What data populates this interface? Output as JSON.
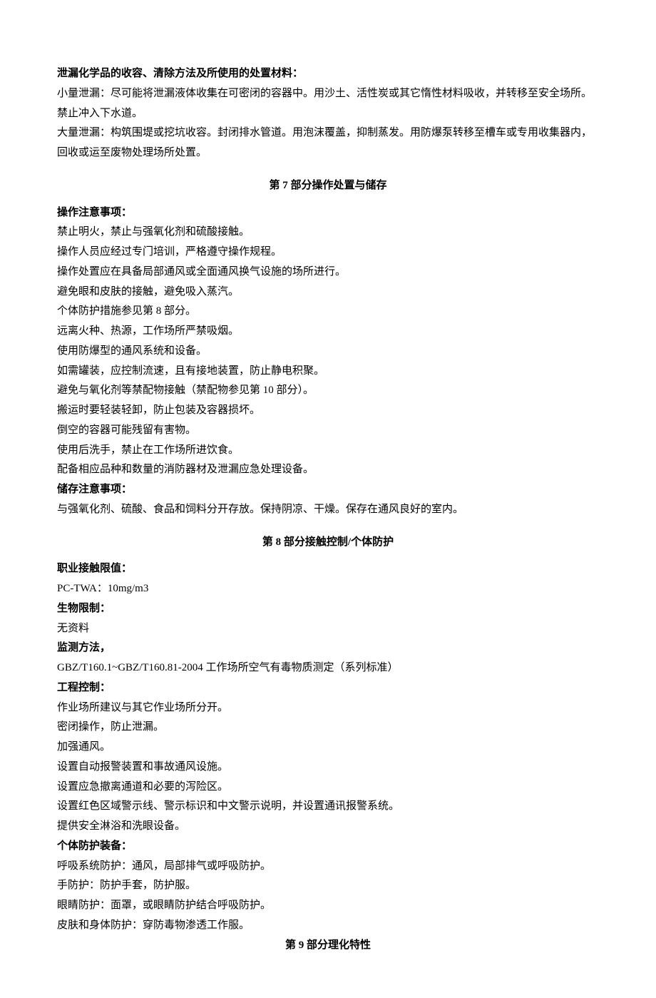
{
  "section6": {
    "heading1": "泄漏化学品的收容、清除方法及所使用的处置材料：",
    "para1": "小量泄漏：尽可能将泄漏液体收集在可密闭的容器中。用沙土、活性炭或其它惰性材料吸收，并转移至安全场所。禁止冲入下水道。",
    "para2": "大量泄漏：构筑围堤或挖坑收容。封闭排水管道。用泡沫覆盖，抑制蒸发。用防爆泵转移至槽车或专用收集器内，回收或运至废物处理场所处置。"
  },
  "section7": {
    "title": "第 7 部分操作处置与储存",
    "heading1": "操作注意事项：",
    "items1": [
      "禁止明火，禁止与强氧化剂和硫酸接触。",
      "操作人员应经过专门培训，严格遵守操作规程。",
      "操作处置应在具备局部通风或全面通风换气设施的场所进行。",
      "避免眼和皮肤的接触，避免吸入蒸汽。",
      "个体防护措施参见第 8 部分。",
      "远离火种、热源，工作场所严禁吸烟。",
      "使用防爆型的通风系统和设备。",
      "如需罐装，应控制流速，且有接地装置，防止静电积聚。",
      "避免与氧化剂等禁配物接触（禁配物参见第 10 部分）。",
      "搬运时要轻装轻卸，防止包装及容器损坏。",
      "倒空的容器可能残留有害物。",
      "使用后洗手，禁止在工作场所进饮食。",
      "配备相应品种和数量的消防器材及泄漏应急处理设备。"
    ],
    "heading2": "储存注意事项：",
    "para2": "与强氧化剂、硫酸、食品和饲料分开存放。保持阴凉、干燥。保存在通风良好的室内。"
  },
  "section8": {
    "title": "第 8 部分接触控制/个体防护",
    "heading1": "职业接触限值：",
    "val1": "PC-TWA：10mg/m3",
    "heading2": "生物限制：",
    "val2": "无资料",
    "heading3": "监测方法，",
    "val3": "GBZ/T160.1~GBZ/T160.81-2004 工作场所空气有毒物质测定（系列标准）",
    "heading4": "工程控制：",
    "items4": [
      "作业场所建议与其它作业场所分开。",
      "密闭操作，防止泄漏。",
      "加强通风。",
      "设置自动报警装置和事故通风设施。",
      "设置应急撤离通道和必要的泻险区。",
      "设置红色区域警示线、警示标识和中文警示说明，并设置通讯报警系统。",
      "提供安全淋浴和洗眼设备。"
    ],
    "heading5": "个体防护装备：",
    "items5": [
      "呼吸系统防护：通风，局部排气或呼吸防护。",
      "手防护：防护手套，防护服。",
      "眼睛防护：面罩，或眼睛防护结合呼吸防护。",
      "皮肤和身体防护：穿防毒物渗透工作服。"
    ]
  },
  "section9": {
    "title": "第 9 部分理化特性"
  }
}
